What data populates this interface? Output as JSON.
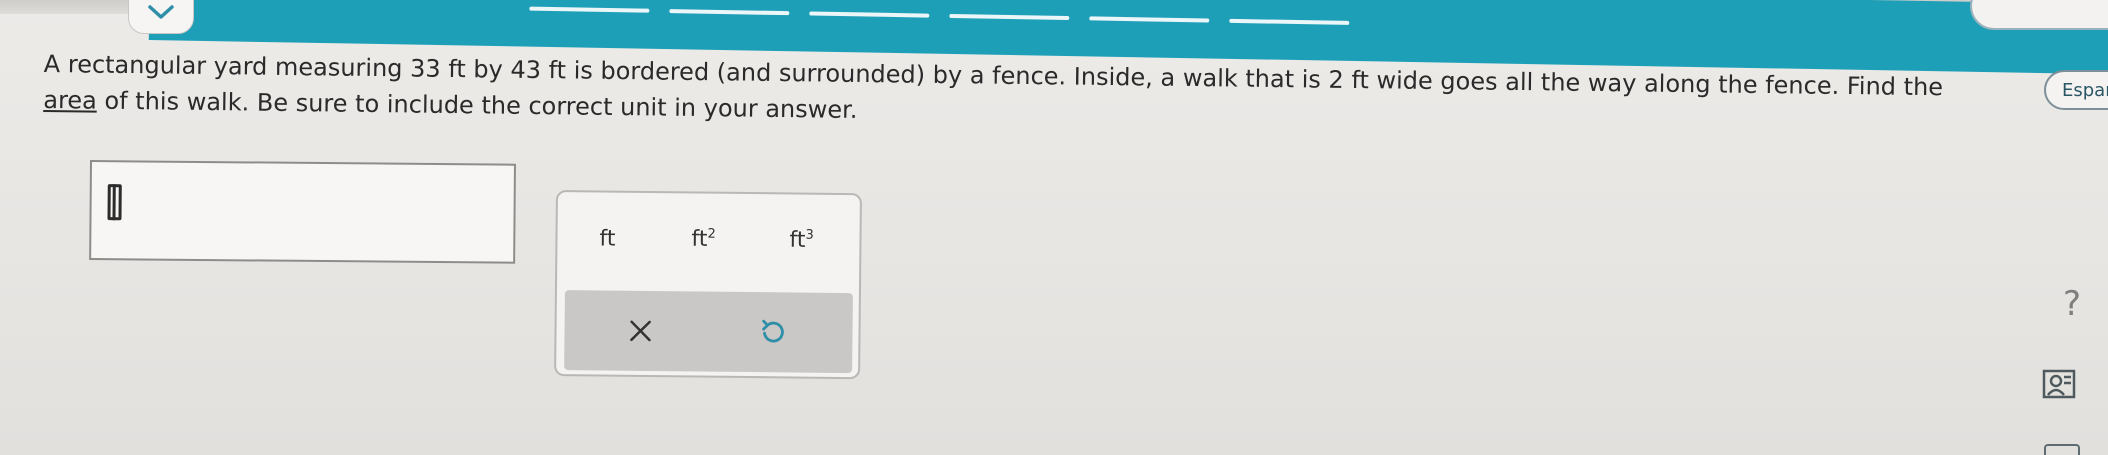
{
  "header": {
    "collapse_icon": "chevron-down-icon"
  },
  "question": {
    "line1": "A rectangular yard measuring 33 ft by 43 ft is bordered (and surrounded) by a fence. Inside, a walk that is 2 ft wide goes all the way along the fence. Find the",
    "link_text": "area",
    "line2_rest": " of this walk. Be sure to include the correct unit in your answer."
  },
  "language_button": {
    "label": "Españ"
  },
  "answer": {
    "value": "",
    "cursor_icon": "text-cursor-icon"
  },
  "unit_panel": {
    "units": [
      {
        "label": "ft",
        "sup": ""
      },
      {
        "label": "ft",
        "sup": "2"
      },
      {
        "label": "ft",
        "sup": "3"
      }
    ],
    "clear_icon": "close-icon",
    "undo_icon": "undo-icon"
  },
  "sidebar_tools": {
    "help_label": "?",
    "help_icon": "help-icon",
    "reader_icon": "reader-icon"
  },
  "colors": {
    "accent": "#1e9fb8",
    "text": "#2a2a2a",
    "panel_footer": "#c9c8c6",
    "language_border": "#7d8f99"
  }
}
